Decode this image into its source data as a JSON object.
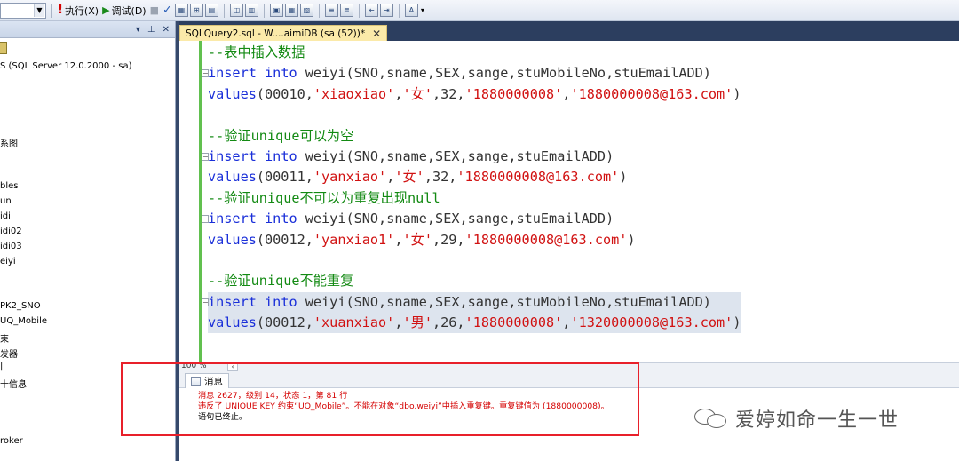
{
  "toolbar": {
    "execute_label": "执行(X)",
    "debug_label": "调试(D)"
  },
  "explorer": {
    "items": [
      "S (SQL Server 12.0.2000 - sa)",
      "系图",
      "bles",
      "un",
      "idi",
      "idi02",
      "idi03",
      "eiyi",
      "PK2_SNO",
      "UQ_Mobile",
      "束",
      "发器",
      "|",
      "十信息",
      "roker"
    ]
  },
  "document_tab": {
    "title": "SQLQuery2.sql - W....aimiDB (sa (52))*",
    "close_glyph": "✕"
  },
  "editor": {
    "lines": [
      {
        "fold": false,
        "selected": false,
        "tokens": [
          {
            "t": "c",
            "v": "--表中插入数据"
          }
        ]
      },
      {
        "fold": true,
        "selected": false,
        "tokens": [
          {
            "t": "k",
            "v": "insert"
          },
          {
            "t": "p",
            "v": " "
          },
          {
            "t": "k",
            "v": "into"
          },
          {
            "t": "p",
            "v": " weiyi(SNO,sname,SEX,sange,stuMobileNo,stuEmailADD)"
          }
        ]
      },
      {
        "fold": false,
        "selected": false,
        "tokens": [
          {
            "t": "k",
            "v": "values"
          },
          {
            "t": "p",
            "v": "(00010,"
          },
          {
            "t": "s",
            "v": "'xiaoxiao'"
          },
          {
            "t": "p",
            "v": ","
          },
          {
            "t": "s",
            "v": "'女'"
          },
          {
            "t": "p",
            "v": ",32,"
          },
          {
            "t": "s",
            "v": "'1880000008'"
          },
          {
            "t": "p",
            "v": ","
          },
          {
            "t": "s",
            "v": "'1880000008@163.com'"
          },
          {
            "t": "p",
            "v": ")"
          }
        ]
      },
      {
        "fold": false,
        "selected": false,
        "tokens": [
          {
            "t": "p",
            "v": ""
          }
        ]
      },
      {
        "fold": false,
        "selected": false,
        "tokens": [
          {
            "t": "c",
            "v": "--验证unique可以为空"
          }
        ]
      },
      {
        "fold": true,
        "selected": false,
        "tokens": [
          {
            "t": "k",
            "v": "insert"
          },
          {
            "t": "p",
            "v": " "
          },
          {
            "t": "k",
            "v": "into"
          },
          {
            "t": "p",
            "v": " weiyi(SNO,sname,SEX,sange,stuEmailADD)"
          }
        ]
      },
      {
        "fold": false,
        "selected": false,
        "tokens": [
          {
            "t": "k",
            "v": "values"
          },
          {
            "t": "p",
            "v": "(00011,"
          },
          {
            "t": "s",
            "v": "'yanxiao'"
          },
          {
            "t": "p",
            "v": ","
          },
          {
            "t": "s",
            "v": "'女'"
          },
          {
            "t": "p",
            "v": ",32,"
          },
          {
            "t": "s",
            "v": "'1880000008@163.com'"
          },
          {
            "t": "p",
            "v": ")"
          }
        ]
      },
      {
        "fold": false,
        "selected": false,
        "tokens": [
          {
            "t": "c",
            "v": "--验证unique不可以为重复出现null"
          }
        ]
      },
      {
        "fold": true,
        "selected": false,
        "tokens": [
          {
            "t": "k",
            "v": "insert"
          },
          {
            "t": "p",
            "v": " "
          },
          {
            "t": "k",
            "v": "into"
          },
          {
            "t": "p",
            "v": " weiyi(SNO,sname,SEX,sange,stuEmailADD)"
          }
        ]
      },
      {
        "fold": false,
        "selected": false,
        "tokens": [
          {
            "t": "k",
            "v": "values"
          },
          {
            "t": "p",
            "v": "(00012,"
          },
          {
            "t": "s",
            "v": "'yanxiao1'"
          },
          {
            "t": "p",
            "v": ","
          },
          {
            "t": "s",
            "v": "'女'"
          },
          {
            "t": "p",
            "v": ",29,"
          },
          {
            "t": "s",
            "v": "'1880000008@163.com'"
          },
          {
            "t": "p",
            "v": ")"
          }
        ]
      },
      {
        "fold": false,
        "selected": false,
        "tokens": [
          {
            "t": "p",
            "v": ""
          }
        ]
      },
      {
        "fold": false,
        "selected": false,
        "tokens": [
          {
            "t": "c",
            "v": "--验证unique不能重复"
          }
        ]
      },
      {
        "fold": true,
        "selected": true,
        "tokens": [
          {
            "t": "k",
            "v": "insert"
          },
          {
            "t": "p",
            "v": " "
          },
          {
            "t": "k",
            "v": "into"
          },
          {
            "t": "p",
            "v": " weiyi(SNO,sname,SEX,sange,stuMobileNo,stuEmailADD)"
          }
        ]
      },
      {
        "fold": false,
        "selected": true,
        "tokens": [
          {
            "t": "k",
            "v": "values"
          },
          {
            "t": "p",
            "v": "(00012,"
          },
          {
            "t": "s",
            "v": "'xuanxiao'"
          },
          {
            "t": "p",
            "v": ","
          },
          {
            "t": "s",
            "v": "'男'"
          },
          {
            "t": "p",
            "v": ",26,"
          },
          {
            "t": "s",
            "v": "'1880000008'"
          },
          {
            "t": "p",
            "v": ","
          },
          {
            "t": "s",
            "v": "'1320000008@163.com'"
          },
          {
            "t": "p",
            "v": ")"
          }
        ]
      }
    ]
  },
  "zoom": {
    "level": "100 %"
  },
  "results": {
    "tab_label": "消息",
    "messages": [
      {
        "kind": "error",
        "text": "消息 2627，级别 14，状态 1，第 81 行"
      },
      {
        "kind": "error",
        "text": "违反了 UNIQUE KEY 约束“UQ_Mobile”。不能在对象“dbo.weiyi”中插入重复键。重复键值为 (1880000008)。"
      },
      {
        "kind": "info",
        "text": "语句已终止。"
      }
    ]
  },
  "watermark": {
    "text": "爱婷如命一生一世"
  },
  "colors": {
    "comment": "#138a13",
    "keyword": "#1a2fd9",
    "string": "#d11212",
    "error": "#d40000",
    "annotation": "#e8202a",
    "tab_active": "#fbeaa9"
  }
}
